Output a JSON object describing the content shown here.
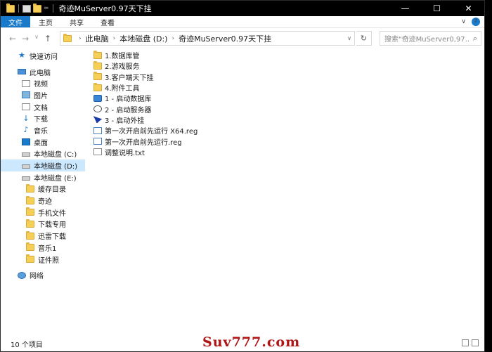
{
  "titlebar": {
    "title": "奇迹MuServer0.97天下挂",
    "controls": {
      "minimize": "—",
      "maximize": "☐",
      "close": "✕"
    }
  },
  "ribbon": {
    "tabs": [
      "文件",
      "主页",
      "共享",
      "查看"
    ],
    "expand_icon": "∨",
    "help_icon": "?"
  },
  "nav": {
    "back": "←",
    "forward": "→",
    "recent": "∨",
    "up": "↑"
  },
  "address": {
    "segments": [
      "此电脑",
      "本地磁盘 (D:)",
      "奇迹MuServer0.97天下挂"
    ],
    "dropdown": "∨",
    "refresh": "↻"
  },
  "search": {
    "placeholder": "搜索\"奇迹MuServer0,97...",
    "icon": "search-icon"
  },
  "sidebar": {
    "items": [
      {
        "label": "快速访问",
        "icon": "star-icon",
        "indent": 1
      },
      {
        "label": "此电脑",
        "icon": "computer-icon",
        "indent": 1
      },
      {
        "label": "视频",
        "icon": "video-icon",
        "indent": 2
      },
      {
        "label": "图片",
        "icon": "picture-icon",
        "indent": 2
      },
      {
        "label": "文档",
        "icon": "document-icon",
        "indent": 2
      },
      {
        "label": "下载",
        "icon": "download-icon",
        "indent": 2
      },
      {
        "label": "音乐",
        "icon": "music-icon",
        "indent": 2
      },
      {
        "label": "桌面",
        "icon": "desktop-icon",
        "indent": 2
      },
      {
        "label": "本地磁盘 (C:)",
        "icon": "drive-icon",
        "indent": 2
      },
      {
        "label": "本地磁盘 (D:)",
        "icon": "drive-icon",
        "indent": 2,
        "selected": true
      },
      {
        "label": "本地磁盘 (E:)",
        "icon": "drive-icon",
        "indent": 2
      },
      {
        "label": "缓存目录",
        "icon": "folder-icon",
        "indent": 3
      },
      {
        "label": "奇迹",
        "icon": "folder-icon",
        "indent": 3
      },
      {
        "label": "手机文件",
        "icon": "folder-icon",
        "indent": 3
      },
      {
        "label": "下载专用",
        "icon": "folder-icon",
        "indent": 3
      },
      {
        "label": "迅雷下载",
        "icon": "folder-icon",
        "indent": 3
      },
      {
        "label": "音乐1",
        "icon": "folder-icon",
        "indent": 3
      },
      {
        "label": "证件照",
        "icon": "folder-icon",
        "indent": 3
      },
      {
        "label": "网络",
        "icon": "network-icon",
        "indent": 1
      }
    ]
  },
  "files": [
    {
      "name": "1.数据库管",
      "icon": "folder-icon"
    },
    {
      "name": "2.游戏服务",
      "icon": "folder-icon"
    },
    {
      "name": "3.客户端天下挂",
      "icon": "folder-icon"
    },
    {
      "name": "4.附件工具",
      "icon": "folder-icon"
    },
    {
      "name": "1 - 启动数据库",
      "icon": "app-icon"
    },
    {
      "name": "2 - 启动服务器",
      "icon": "app-icon"
    },
    {
      "name": "3 - 启动外挂",
      "icon": "app-icon"
    },
    {
      "name": "第一次开启前先运行 X64.reg",
      "icon": "registry-icon"
    },
    {
      "name": "第一次开启前先运行.reg",
      "icon": "registry-icon"
    },
    {
      "name": "调整说明.txt",
      "icon": "text-file-icon"
    }
  ],
  "status": {
    "count": "10 个项目"
  },
  "watermark": {
    "text": "Suv777.com"
  }
}
